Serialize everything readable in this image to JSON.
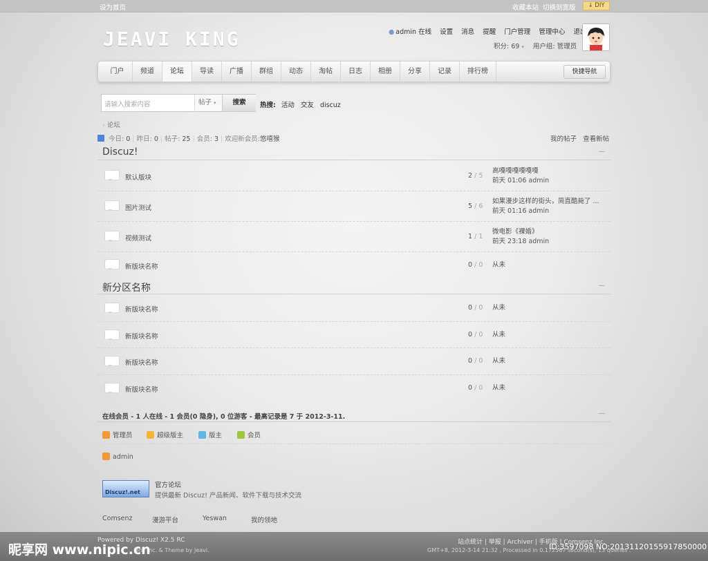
{
  "topbar": {
    "set_home": "设为首页",
    "bookmark": "收藏本站",
    "wide": "切换到宽版",
    "diy": "DIY"
  },
  "logo": "JEAVI KING",
  "user": {
    "name_status": "admin 在线",
    "links": [
      "设置",
      "消息",
      "提醒",
      "门户管理",
      "管理中心",
      "退出"
    ],
    "points": "积分: 69",
    "group": "用户组: 管理员"
  },
  "nav": {
    "items": [
      "门户",
      "频道",
      "论坛",
      "导读",
      "广播",
      "群组",
      "动态",
      "淘帖",
      "日志",
      "相册",
      "分享",
      "记录",
      "排行榜"
    ],
    "active": "论坛",
    "quick": "快捷导航"
  },
  "search": {
    "placeholder": "请输入搜索内容",
    "type": "帖子",
    "button": "搜索"
  },
  "hot": {
    "label": "热搜:",
    "items": [
      "活动",
      "交友",
      "discuz"
    ]
  },
  "breadcrumb": "论坛",
  "stats": {
    "today_label": "今日:",
    "today": "0",
    "yesterday_label": "昨日:",
    "yesterday": "0",
    "posts_label": "帖子:",
    "posts": "25",
    "members_label": "会员:",
    "members": "3",
    "welcome": "欢迎新会员:",
    "newuser": "悠嘻猴"
  },
  "mylinks": {
    "myposts": "我的帖子",
    "newposts": "查看新帖"
  },
  "sections": [
    {
      "title": "Discuz!",
      "forums": [
        {
          "name": "默认版块",
          "threads": "2",
          "posts": "5",
          "last_title": "高嘎嘎嘎嘎嘎嘎",
          "last_info": "前天 01:06 admin"
        },
        {
          "name": "图片测试",
          "threads": "5",
          "posts": "6",
          "last_title": "如果漫步这样的街头，简直酷毙了 ...",
          "last_info": "前天 01:16 admin"
        },
        {
          "name": "视频测试",
          "threads": "1",
          "posts": "1",
          "last_title": "微电影《裸婚》",
          "last_info": "前天 23:18 admin"
        },
        {
          "name": "新版块名称",
          "threads": "0",
          "posts": "0",
          "last_title": "从未",
          "last_info": ""
        }
      ]
    },
    {
      "title": "新分区名称",
      "forums": [
        {
          "name": "新版块名称",
          "threads": "0",
          "posts": "0",
          "last_title": "从未",
          "last_info": ""
        },
        {
          "name": "新版块名称",
          "threads": "0",
          "posts": "0",
          "last_title": "从未",
          "last_info": ""
        },
        {
          "name": "新版块名称",
          "threads": "0",
          "posts": "0",
          "last_title": "从未",
          "last_info": ""
        },
        {
          "name": "新版块名称",
          "threads": "0",
          "posts": "0",
          "last_title": "从未",
          "last_info": ""
        }
      ]
    }
  ],
  "online": {
    "summary": "在线会员 - 1 人在线 - 1 会员(0 隐身), 0 位游客 - 最高记录是 7 于 2012-3-11.",
    "legend": [
      "管理员",
      "超级版主",
      "版主",
      "会员"
    ],
    "legend_colors": [
      "#f29a3a",
      "#f2b53a",
      "#5fb6e6",
      "#9bc93a"
    ],
    "users": [
      "admin"
    ]
  },
  "official": {
    "logo_text": "Discuz!.net",
    "title": "官方论坛",
    "desc": "提供最新 Discuz! 产品新闻、软件下载与技术交流"
  },
  "friendlinks": [
    "Comsenz",
    "漫游平台",
    "Yeswan",
    "我的领地"
  ],
  "footer": {
    "powered": "Powered by Discuz! X2.5 RC",
    "copyright": "enz Inc. & Theme by Jeavi.",
    "links": "站点统计 | 举报 | Archiver | 手机版 | Comsenz Inc.",
    "gmt": "GMT+8, 2012-3-14 21:32 , Processed in 0.172567 second(s), 13 queries ."
  },
  "watermark": {
    "site": "昵享网 www.nipic.cn",
    "id": "ID:3597098 NO:20131120155917850000"
  }
}
